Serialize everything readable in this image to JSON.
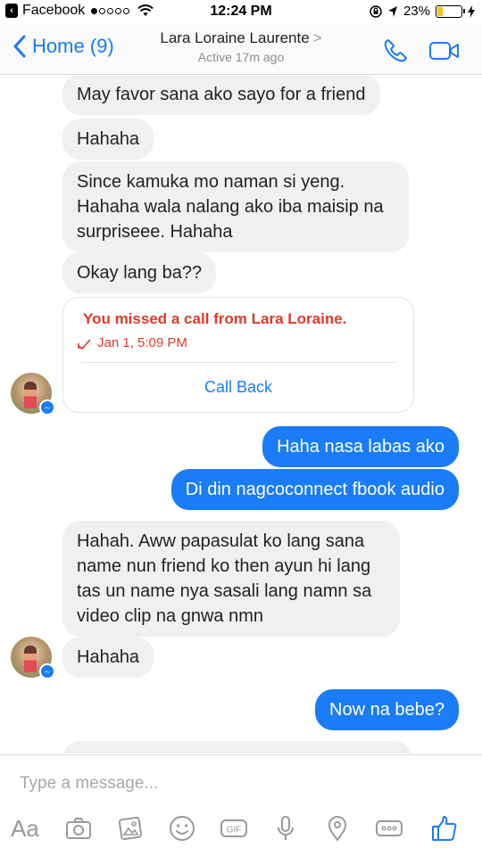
{
  "status_bar": {
    "carrier": "Facebook",
    "time": "12:24 PM",
    "battery_text": "23%",
    "battery_level": 0.23
  },
  "header": {
    "back_label": "Home (9)",
    "contact_name": "Lara Loraine Laurente",
    "name_chevron": ">",
    "active_status": "Active 17m ago"
  },
  "messages": {
    "m1": "May favor sana ako sayo for a friend",
    "m2": "Hahaha",
    "m3_line1": "Since kamuka mo naman si yeng.",
    "m3_line2": "Hahaha wala nalang ako iba maisip na",
    "m3_line3": "surpriseee. Hahaha",
    "m4": "Okay lang ba??",
    "call": {
      "title": "You missed a call from Lara Loraine.",
      "time": "Jan 1, 5:09 PM",
      "action": "Call Back"
    },
    "m5": "Haha nasa labas ako",
    "m6": "Di din nagcoconnect fbook audio",
    "m7_line1": "Hahah. Aww papasulat ko lang sana",
    "m7_line2": "name nun friend ko then ayun hi lang",
    "m7_line3": "tas un name nya sasali lang namn sa",
    "m7_line4": "video clip na gnwa nmn",
    "m8": "Hahaha",
    "m9": "Now na bebe?"
  },
  "composer": {
    "placeholder": "Type a message...",
    "aa_label": "Aa",
    "gif_label": "GIF"
  },
  "colors": {
    "accent": "#1a7cf6",
    "incoming_bubble": "#f1f0f0",
    "missed_call": "#e0392b"
  }
}
